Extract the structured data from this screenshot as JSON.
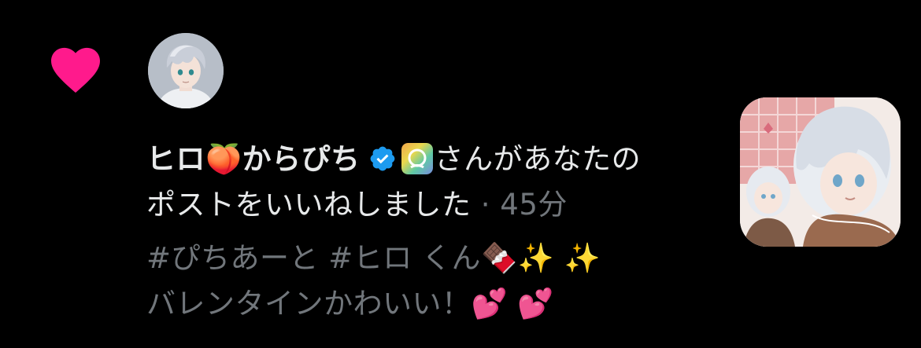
{
  "notification": {
    "type_icon": "heart-icon",
    "avatar_icon": "avatar-portrait",
    "display_name": "ヒロ🍑からぴち",
    "verified_icon": "verified-badge-icon",
    "app_icon": "colorful-app-icon",
    "action_text_line1": "さんがあなたの",
    "action_text_line2": "ポストをいいねしました",
    "separator": " · ",
    "timestamp": "45分",
    "post": {
      "line1_tags": "#ぴちあーと  #ヒロ くん",
      "line1_emoji_chocolate": "🍫",
      "line1_emoji_sparkles": " ✨ ✨",
      "line2_text": "バレンタインかわいい！",
      "line2_emoji_hearts": "💕 💕"
    },
    "thumbnail_icon": "post-image-thumbnail"
  },
  "colors": {
    "background": "#000000",
    "primary_text": "#e7e9ea",
    "secondary_text": "#71767b",
    "heart": "#ff1a8c",
    "verified": "#1d9bf0"
  }
}
